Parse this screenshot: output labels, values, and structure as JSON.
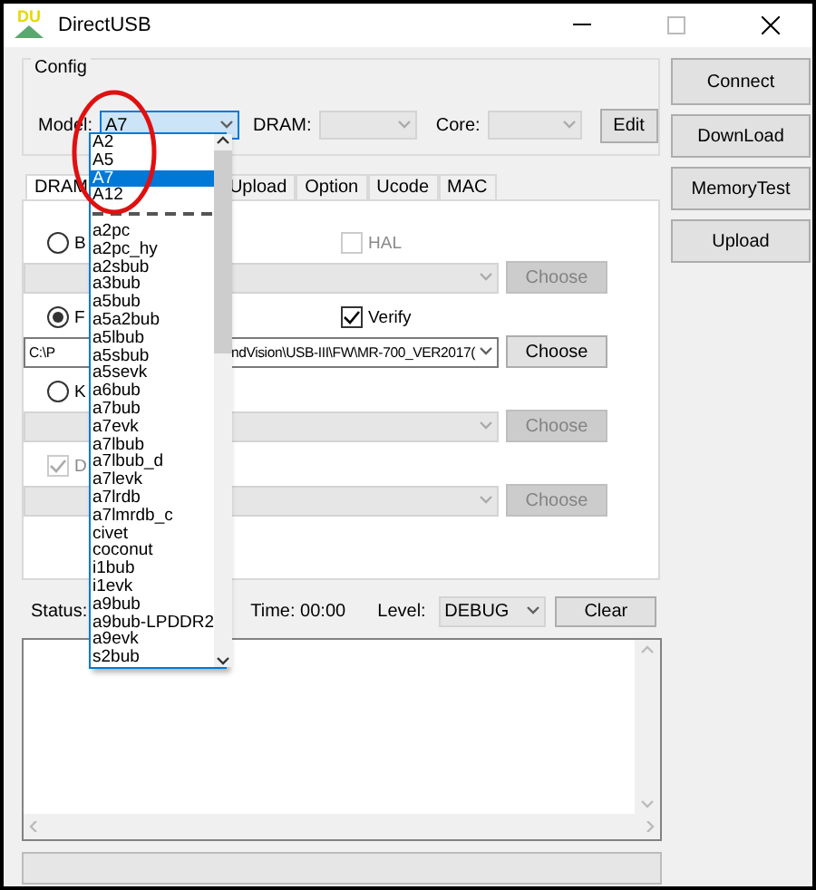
{
  "window": {
    "logo": "DU",
    "title": "DirectUSB"
  },
  "config": {
    "legend": "Config",
    "model_label": "Model:",
    "model_value": "A7",
    "dram_label": "DRAM:",
    "core_label": "Core:",
    "edit_button": "Edit"
  },
  "model_dropdown": {
    "items": [
      {
        "kind": "item",
        "label": "A2",
        "selected": false
      },
      {
        "kind": "item",
        "label": "A5",
        "selected": false
      },
      {
        "kind": "item",
        "label": "A7",
        "selected": true
      },
      {
        "kind": "item",
        "label": "A12",
        "selected": false
      },
      {
        "kind": "separator"
      },
      {
        "kind": "item",
        "label": "a2pc",
        "selected": false
      },
      {
        "kind": "item",
        "label": "a2pc_hy",
        "selected": false
      },
      {
        "kind": "item",
        "label": "a2sbub",
        "selected": false
      },
      {
        "kind": "item",
        "label": "a3bub",
        "selected": false
      },
      {
        "kind": "item",
        "label": "a5bub",
        "selected": false
      },
      {
        "kind": "item",
        "label": "a5a2bub",
        "selected": false
      },
      {
        "kind": "item",
        "label": "a5lbub",
        "selected": false
      },
      {
        "kind": "item",
        "label": "a5sbub",
        "selected": false
      },
      {
        "kind": "item",
        "label": "a5sevk",
        "selected": false
      },
      {
        "kind": "item",
        "label": "a6bub",
        "selected": false
      },
      {
        "kind": "item",
        "label": "a7bub",
        "selected": false
      },
      {
        "kind": "item",
        "label": "a7evk",
        "selected": false
      },
      {
        "kind": "item",
        "label": "a7lbub",
        "selected": false
      },
      {
        "kind": "item",
        "label": "a7lbub_d",
        "selected": false
      },
      {
        "kind": "item",
        "label": "a7levk",
        "selected": false
      },
      {
        "kind": "item",
        "label": "a7lrdb",
        "selected": false
      },
      {
        "kind": "item",
        "label": "a7lmrdb_c",
        "selected": false
      },
      {
        "kind": "item",
        "label": "civet",
        "selected": false
      },
      {
        "kind": "item",
        "label": "coconut",
        "selected": false
      },
      {
        "kind": "item",
        "label": "i1bub",
        "selected": false
      },
      {
        "kind": "item",
        "label": "i1evk",
        "selected": false
      },
      {
        "kind": "item",
        "label": "a9bub",
        "selected": false
      },
      {
        "kind": "item",
        "label": "a9bub-LPDDR2",
        "selected": false
      },
      {
        "kind": "item",
        "label": "a9evk",
        "selected": false
      },
      {
        "kind": "item",
        "label": "s2bub",
        "selected": false
      }
    ]
  },
  "tabs": [
    {
      "label": "DRAM",
      "selected": true
    },
    {
      "label": "Upload",
      "selected": false
    },
    {
      "label": "Option",
      "selected": false
    },
    {
      "label": "Ucode",
      "selected": false
    },
    {
      "label": "MAC",
      "selected": false
    }
  ],
  "sections": [
    {
      "lead": {
        "kind": "radio",
        "label": "B",
        "on": false
      },
      "checkbox": {
        "label": "HAL",
        "checked": false,
        "disabled": true
      },
      "file": {
        "disabled": true
      },
      "choose": {
        "label": "Choose",
        "disabled": true
      }
    },
    {
      "lead": {
        "kind": "radio",
        "label": "F",
        "on": true
      },
      "checkbox": {
        "label": "Verify",
        "checked": true,
        "disabled": false
      },
      "file": {
        "disabled": false,
        "value_start": "C:\\P",
        "value_end": "ndVision\\USB-III\\FW\\MR-700_VER2017("
      },
      "choose": {
        "label": "Choose",
        "disabled": false
      }
    },
    {
      "lead": {
        "kind": "radio",
        "label": "K",
        "on": false
      },
      "file": {
        "disabled": true
      },
      "choose": {
        "label": "Choose",
        "disabled": true
      }
    },
    {
      "lead": {
        "kind": "checkbox",
        "label": "D",
        "on": true,
        "disabled": true
      },
      "file": {
        "disabled": true
      },
      "choose": {
        "label": "Choose",
        "disabled": true
      }
    }
  ],
  "status_row": {
    "status_label": "Status:",
    "time": "Time: 00:00",
    "level_label": "Level:",
    "level_value": "DEBUG",
    "clear_button": "Clear"
  },
  "progress": {
    "level": 0
  },
  "side_buttons": [
    "Connect",
    "DownLoad",
    "MemoryTest",
    "Upload"
  ]
}
